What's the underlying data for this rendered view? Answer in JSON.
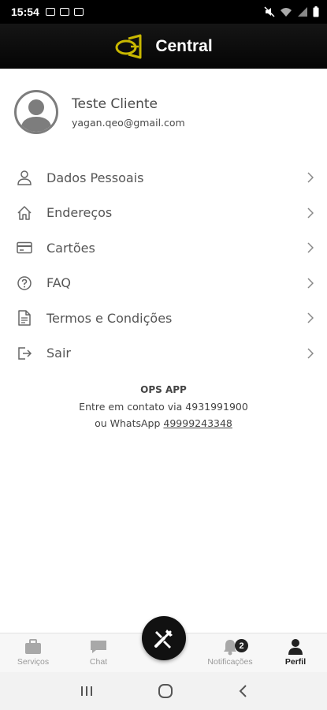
{
  "status_bar": {
    "time": "15:54"
  },
  "header": {
    "title": "Central"
  },
  "profile": {
    "name": "Teste Cliente",
    "email": "yagan.qeo@gmail.com"
  },
  "menu": [
    {
      "label": "Dados Pessoais",
      "icon": "user-icon"
    },
    {
      "label": "Endereços",
      "icon": "home-icon"
    },
    {
      "label": "Cartões",
      "icon": "credit-card-icon"
    },
    {
      "label": "FAQ",
      "icon": "help-circle-icon"
    },
    {
      "label": "Termos e Condições",
      "icon": "document-icon"
    },
    {
      "label": "Sair",
      "icon": "logout-icon"
    }
  ],
  "info": {
    "app_name": "OPS APP",
    "contact_line": "Entre em contato via 4931991900",
    "whatsapp_prefix": "ou WhatsApp ",
    "whatsapp_number": "49999243348"
  },
  "bottom_nav": {
    "items": [
      {
        "label": "Serviços",
        "icon": "services-icon",
        "active": false
      },
      {
        "label": "Chat",
        "icon": "chat-icon",
        "active": false
      },
      {
        "label": "Notificações",
        "icon": "bell-icon",
        "active": false,
        "badge": "2"
      },
      {
        "label": "Perfil",
        "icon": "person-icon",
        "active": true
      }
    ],
    "fab_icon": "tools-icon"
  },
  "colors": {
    "accent": "#c9b800",
    "header_bg": "#0a0a0a",
    "text": "#555555"
  }
}
